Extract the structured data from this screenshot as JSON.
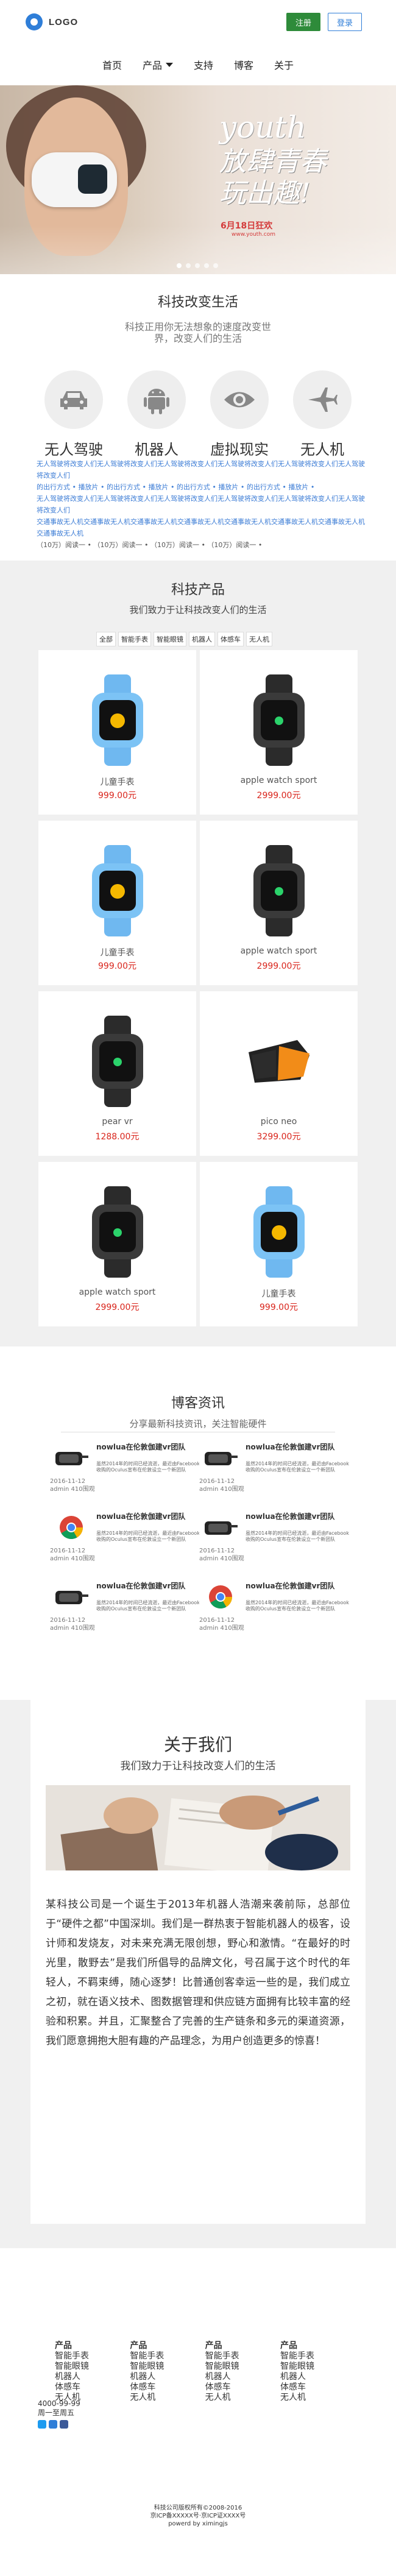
{
  "header": {
    "logo_text": "LOGO",
    "login_label": "注册",
    "register_label": "登录"
  },
  "nav": {
    "items": [
      "首页",
      "产品",
      "支持",
      "博客",
      "关于"
    ]
  },
  "hero": {
    "title_en": "youth",
    "title_cn_line1": "放肆青春",
    "title_cn_line2": "玩出趣!",
    "date": "6月18日狂欢",
    "sub": "www.youth.com"
  },
  "features": {
    "title": "科技改变生活",
    "subtitle": "科技正用你无法想象的速度改变世界，改变人们的生活",
    "items": [
      {
        "label": "无人驾驶",
        "icon": "car-icon"
      },
      {
        "label": "机器人",
        "icon": "android-icon"
      },
      {
        "label": "虚拟现实",
        "icon": "eye-icon"
      },
      {
        "label": "无人机",
        "icon": "plane-icon"
      }
    ],
    "desc_line1": "无人驾驶将改变人们无人驾驶将改变人们无人驾驶将改变人们无人驾驶将改变人们无人驾驶将改变人们无人驾驶将改变人们",
    "desc_line2": "的出行方式 • 播放片 • 的出行方式 • 播放片 • 的出行方式 • 播放片 • 的出行方式 • 播放片 •",
    "desc_line3": "无人驾驶将改变人们无人驾驶将改变人们无人驾驶将改变人们无人驾驶将改变人们无人驾驶将改变人们无人驾驶将改变人们",
    "desc_line4": "交通事故无人机交通事故无人机交通事故无人机交通事故无人机交通事故无人机交通事故无人机交通事故无人机交通事故无人机",
    "more_line": "（10万）阅读一 •   （10万）阅读一 •   （10万）阅读一 •   （10万）阅读一 •"
  },
  "products": {
    "title": "科技产品",
    "subtitle": "我们致力于让科技改变人们的生活",
    "filters": [
      "全部",
      "智能手表",
      "智能眼镜",
      "机器人",
      "体感车",
      "无人机"
    ],
    "items": [
      {
        "name": "儿童手表",
        "price": "999.00元",
        "style": "kid"
      },
      {
        "name": "apple watch sport",
        "price": "2999.00元",
        "style": "black"
      },
      {
        "name": "儿童手表",
        "price": "999.00元",
        "style": "kid"
      },
      {
        "name": "apple watch sport",
        "price": "2999.00元",
        "style": "black"
      },
      {
        "name": "pear vr",
        "price": "1288.00元",
        "style": "black"
      },
      {
        "name": "pico neo",
        "price": "3299.00元",
        "style": "vr"
      },
      {
        "name": "apple watch sport",
        "price": "2999.00元",
        "style": "black"
      },
      {
        "name": "儿童手表",
        "price": "999.00元",
        "style": "kid"
      }
    ]
  },
  "blog": {
    "title": "博客资讯",
    "subtitle": "分享最新科技资讯，关注智能硬件",
    "items": [
      {
        "head": "nowlua在伦敦伽建vr团队",
        "snip": "虽然2014年的时间已经流逝，最近由Facebook收购的Oculus宣布在伦敦设立一个新团队",
        "date": "2016-11-12",
        "meta": "admin 410围观",
        "thumb": "vr"
      },
      {
        "head": "nowlua在伦敦伽建vr团队",
        "snip": "虽然2014年的时间已经流逝，最近由Facebook收购的Oculus宣布在伦敦设立一个新团队",
        "date": "2016-11-12",
        "meta": "admin 410围观",
        "thumb": "vr"
      },
      {
        "head": "nowlua在伦敦伽建vr团队",
        "snip": "虽然2014年的时间已经流逝，最近由Facebook收购的Oculus宣布在伦敦设立一个新团队",
        "date": "2016-11-12",
        "meta": "admin 410围观",
        "thumb": "chrome"
      },
      {
        "head": "nowlua在伦敦伽建vr团队",
        "snip": "虽然2014年的时间已经流逝，最近由Facebook收购的Oculus宣布在伦敦设立一个新团队",
        "date": "2016-11-12",
        "meta": "admin 410围观",
        "thumb": "vr"
      },
      {
        "head": "nowlua在伦敦伽建vr团队",
        "snip": "虽然2014年的时间已经流逝，最近由Facebook收购的Oculus宣布在伦敦设立一个新团队",
        "date": "2016-11-12",
        "meta": "admin 410围观",
        "thumb": "vr"
      },
      {
        "head": "nowlua在伦敦伽建vr团队",
        "snip": "虽然2014年的时间已经流逝，最近由Facebook收购的Oculus宣布在伦敦设立一个新团队",
        "date": "2016-11-12",
        "meta": "admin 410围观",
        "thumb": "chrome"
      }
    ]
  },
  "about": {
    "title": "关于我们",
    "subtitle": "我们致力于让科技改变人们的生活",
    "paragraph": "某科技公司是一个诞生于2013年机器人浩潮来袭前际，总部位于“硬件之都”中国深圳。我们是一群热衷于智能机器人的极客，设计师和发烧友，对未来充满无限创想，野心和激情。“在最好的时光里，散野去”是我们所倡导的品牌文化，号召属于这个时代的年轻人，不羁束缚，随心逐梦！比普通创客幸运一些的是，我们成立之初，就在语义技术、图数据管理和供应链方面拥有比较丰富的经验和积累。并且，汇聚整合了完善的生产链条和多元的渠道资源，我们愿意拥抱大胆有趣的产品理念，为用户创造更多的惊喜！"
  },
  "footer": {
    "columns": [
      {
        "heading": "产品",
        "links": [
          "智能手表",
          "智能眼镜",
          "机器人",
          "体感车",
          "无人机"
        ]
      },
      {
        "heading": "产品",
        "links": [
          "智能手表",
          "智能眼镜",
          "机器人",
          "体感车",
          "无人机"
        ]
      },
      {
        "heading": "产品",
        "links": [
          "智能手表",
          "智能眼镜",
          "机器人",
          "体感车",
          "无人机"
        ]
      },
      {
        "heading": "产品",
        "links": [
          "智能手表",
          "智能眼镜",
          "机器人",
          "体感车",
          "无人机"
        ]
      }
    ],
    "phone": "4000-99-99",
    "hours": "周一至周五",
    "copyright_line1": "科技公司版权所有©2008-2016",
    "copyright_line2": "京ICP备XXXXX号·京ICP证XXXX号",
    "copyright_line3": "powerd by ximingjs"
  }
}
